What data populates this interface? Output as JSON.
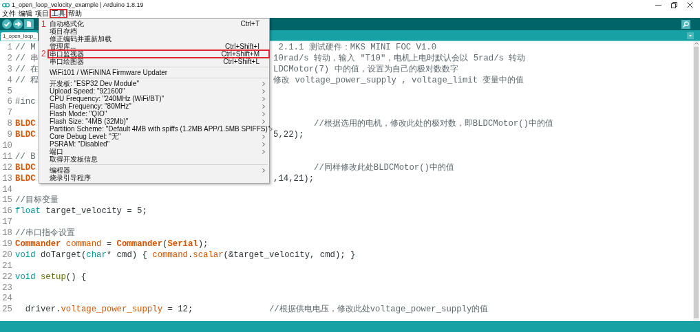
{
  "window": {
    "title": "1_open_loop_velocity_example | Arduino 1.8.19"
  },
  "menubar": [
    {
      "label": "文件",
      "selected": false
    },
    {
      "label": "编辑",
      "selected": false
    },
    {
      "label": "项目",
      "selected": false
    },
    {
      "label": "工具",
      "selected": true,
      "annotation": "1"
    },
    {
      "label": "帮助",
      "selected": false
    }
  ],
  "tabs": [
    {
      "label": "1_open_loop_",
      "selected": true
    }
  ],
  "menu": [
    {
      "kind": "item",
      "label": "自动格式化",
      "shortcut": "Ctrl+T",
      "submenu": false
    },
    {
      "kind": "item",
      "label": "项目存档",
      "submenu": false
    },
    {
      "kind": "item",
      "label": "修正编码并重新加载",
      "submenu": false
    },
    {
      "kind": "item",
      "label": "管理库...",
      "shortcut": "Ctrl+Shift+I",
      "submenu": false
    },
    {
      "kind": "item",
      "label": "串口监视器",
      "shortcut": "Ctrl+Shift+M",
      "submenu": false,
      "annotation": "2"
    },
    {
      "kind": "item",
      "label": "串口绘图器",
      "shortcut": "Ctrl+Shift+L",
      "submenu": false
    },
    {
      "kind": "separator"
    },
    {
      "kind": "item",
      "label": "WiFi101 / WiFiNINA Firmware Updater",
      "submenu": false
    },
    {
      "kind": "separator"
    },
    {
      "kind": "item",
      "label": "开发板: \"ESP32 Dev Module\"",
      "submenu": true
    },
    {
      "kind": "item",
      "label": "Upload Speed: \"921600\"",
      "submenu": true
    },
    {
      "kind": "item",
      "label": "CPU Frequency: \"240MHz (WiFi/BT)\"",
      "submenu": true
    },
    {
      "kind": "item",
      "label": "Flash Frequency: \"80MHz\"",
      "submenu": true
    },
    {
      "kind": "item",
      "label": "Flash Mode: \"QIO\"",
      "submenu": true
    },
    {
      "kind": "item",
      "label": "Flash Size: \"4MB (32Mb)\"",
      "submenu": true
    },
    {
      "kind": "item",
      "label": "Partition Scheme: \"Default 4MB with spiffs (1.2MB APP/1.5MB SPIFFS)\"",
      "submenu": true
    },
    {
      "kind": "item",
      "label": "Core Debug Level: \"无\"",
      "submenu": true
    },
    {
      "kind": "item",
      "label": "PSRAM: \"Disabled\"",
      "submenu": true
    },
    {
      "kind": "item",
      "label": "端口",
      "submenu": true
    },
    {
      "kind": "item",
      "label": "取得开发板信息",
      "submenu": false
    },
    {
      "kind": "separator"
    },
    {
      "kind": "item",
      "label": "编程器",
      "submenu": true
    },
    {
      "kind": "item",
      "label": "烧录引导程序",
      "submenu": false
    }
  ],
  "code": [
    {
      "number": "1",
      "left": [
        {
          "text": "// M",
          "kind": "comment"
        }
      ],
      "right": [
        {
          "text": " 2.1.1 测试硬件：MKS MINI FOC V1.0",
          "kind": "comment"
        }
      ]
    },
    {
      "number": "2",
      "left": [
        {
          "text": "// 串",
          "kind": "comment"
        }
      ],
      "right": [
        {
          "text": "10rad/s 转动，输入 \"T10\"，电机上电时默认会以 5rad/s 转动",
          "kind": "comment"
        }
      ]
    },
    {
      "number": "3",
      "left": [
        {
          "text": "// 在",
          "kind": "comment"
        }
      ],
      "right": [
        {
          "text": "LDCMotor(7) 中的值，设置为自己的极对数数字",
          "kind": "comment"
        }
      ]
    },
    {
      "number": "4",
      "left": [
        {
          "text": "// 程",
          "kind": "comment"
        }
      ],
      "right": [
        {
          "text": "修改 voltage_power_supply , voltage_limit 变量中的值",
          "kind": "comment"
        }
      ]
    },
    {
      "number": "5"
    },
    {
      "number": "6",
      "left": [
        {
          "text": "#inc",
          "kind": "comment"
        }
      ]
    },
    {
      "number": "7"
    },
    {
      "number": "8",
      "left": [
        {
          "text": "BLDC",
          "kind": "keyword"
        }
      ],
      "right": [
        {
          "text": "        //根据选用的电机，修改此处的极对数，即BLDCMotor()中的值",
          "kind": "comment"
        }
      ]
    },
    {
      "number": "9",
      "left": [
        {
          "text": "BLDC",
          "kind": "keyword"
        }
      ],
      "right": [
        {
          "text": "5,22);",
          "kind": "plain"
        }
      ]
    },
    {
      "number": "10"
    },
    {
      "number": "11",
      "left": [
        {
          "text": "// B",
          "kind": "comment"
        }
      ]
    },
    {
      "number": "12",
      "left": [
        {
          "text": "BLDC",
          "kind": "keyword"
        }
      ],
      "right": [
        {
          "text": "        //同样修改此处BLDCMotor()中的值",
          "kind": "comment"
        }
      ]
    },
    {
      "number": "13",
      "left": [
        {
          "text": "BLDC",
          "kind": "keyword"
        }
      ],
      "right": [
        {
          "text": ",14,21);",
          "kind": "plain"
        }
      ]
    },
    {
      "number": "14"
    },
    {
      "number": "15",
      "tokens": [
        {
          "text": "//目标变量",
          "kind": "comment"
        }
      ]
    },
    {
      "number": "16",
      "tokens": [
        {
          "text": "float",
          "kind": "type"
        },
        {
          "text": " target_velocity = 5;",
          "kind": "plain"
        }
      ]
    },
    {
      "number": "17"
    },
    {
      "number": "18",
      "tokens": [
        {
          "text": "//串口指令设置",
          "kind": "comment"
        }
      ]
    },
    {
      "number": "19",
      "tokens": [
        {
          "text": "Commander",
          "kind": "keyword"
        },
        {
          "text": " command",
          "kind": "method"
        },
        {
          "text": " = ",
          "kind": "plain"
        },
        {
          "text": "Commander",
          "kind": "keyword"
        },
        {
          "text": "(",
          "kind": "plain"
        },
        {
          "text": "Serial",
          "kind": "keyword"
        },
        {
          "text": ");",
          "kind": "plain"
        }
      ]
    },
    {
      "number": "20",
      "tokens": [
        {
          "text": "void",
          "kind": "type"
        },
        {
          "text": " doTarget(",
          "kind": "plain"
        },
        {
          "text": "char",
          "kind": "type"
        },
        {
          "text": "* cmd) { ",
          "kind": "plain"
        },
        {
          "text": "command",
          "kind": "method"
        },
        {
          "text": ".",
          "kind": "plain"
        },
        {
          "text": "scalar",
          "kind": "method"
        },
        {
          "text": "(&target_velocity, cmd); }",
          "kind": "plain"
        }
      ]
    },
    {
      "number": "21"
    },
    {
      "number": "22",
      "tokens": [
        {
          "text": "void",
          "kind": "type"
        },
        {
          "text": " setup",
          "kind": "func"
        },
        {
          "text": "() {",
          "kind": "plain"
        }
      ]
    },
    {
      "number": "23"
    },
    {
      "number": "24"
    },
    {
      "number": "25",
      "tokens": [
        {
          "text": "  driver.",
          "kind": "plain"
        },
        {
          "text": "voltage_power_supply",
          "kind": "method"
        },
        {
          "text": " = 12;",
          "kind": "plain"
        },
        {
          "text": "               //根据供电电压，修改此处voltage_power_supply的值",
          "kind": "comment"
        }
      ]
    }
  ]
}
